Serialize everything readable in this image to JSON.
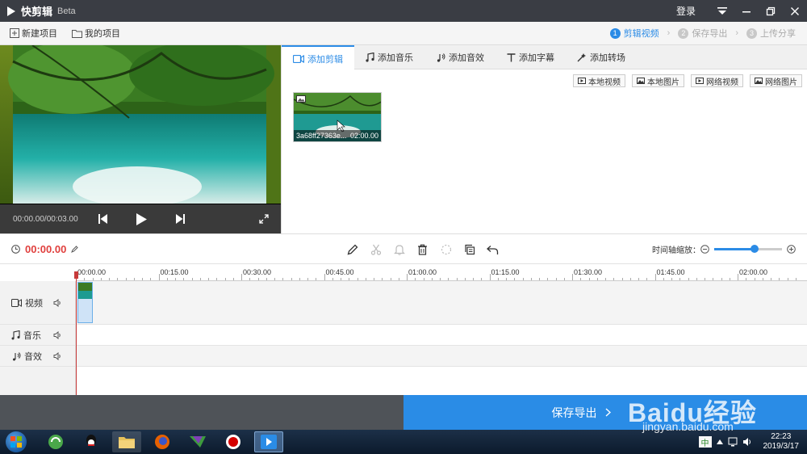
{
  "titlebar": {
    "app_name": "快剪辑",
    "beta": "Beta",
    "login": "登录"
  },
  "toolbar": {
    "new_project": "新建项目",
    "my_project": "我的项目"
  },
  "steps": [
    {
      "num": "1",
      "label": "剪辑视频",
      "active": true
    },
    {
      "num": "2",
      "label": "保存导出",
      "active": false
    },
    {
      "num": "3",
      "label": "上传分享",
      "active": false
    }
  ],
  "preview": {
    "timecode": "00:00.00/00:03.00"
  },
  "media": {
    "tabs": [
      "添加剪辑",
      "添加音乐",
      "添加音效",
      "添加字幕",
      "添加转场"
    ],
    "source_buttons": [
      "本地视频",
      "本地图片",
      "网络视频",
      "网络图片"
    ],
    "thumb": {
      "name": "3a68ff27363e...",
      "duration": "02:00.00"
    }
  },
  "editbar": {
    "time": "00:00.00",
    "zoom_label": "时间轴缩放：",
    "zoom_level": 0.6
  },
  "timeline": {
    "ticks": [
      "00:00.00",
      "00:15.00",
      "00:30.00",
      "00:45.00",
      "01:00.00",
      "01:15.00",
      "01:30.00",
      "01:45.00",
      "02:00.00"
    ],
    "tracks": [
      "视频",
      "音乐",
      "音效"
    ]
  },
  "bottom": {
    "save_label": "保存导出"
  },
  "taskbar": {
    "time": "22:23",
    "date": "2019/3/17",
    "ime": "中"
  },
  "watermark": {
    "brand": "Baidu经验",
    "url": "jingyan.baidu.com"
  },
  "colors": {
    "accent": "#2a8ce6",
    "title_bg": "#3a3d44",
    "timecode_red": "#e0403e"
  }
}
